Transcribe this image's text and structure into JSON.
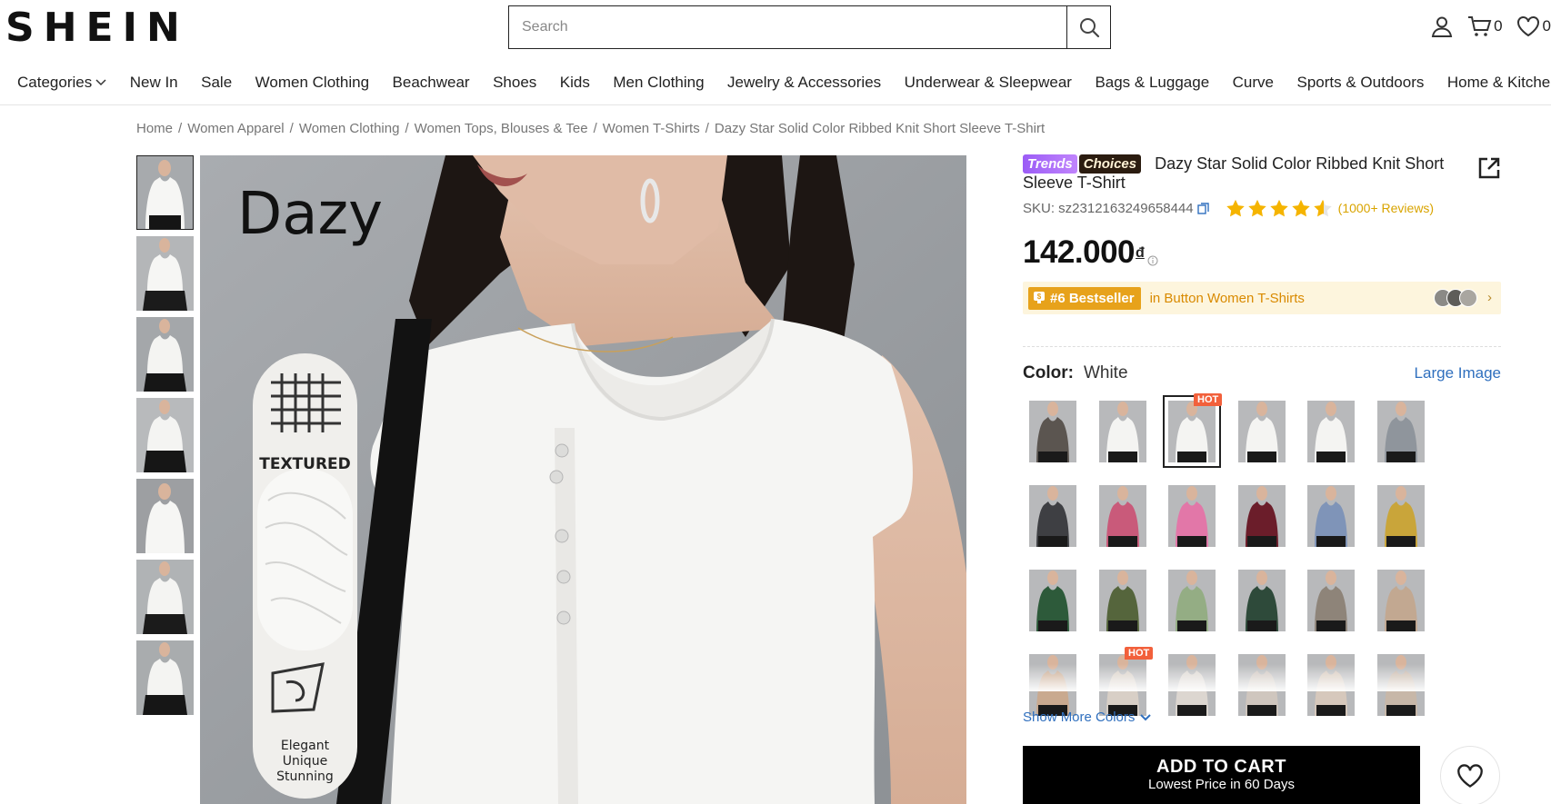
{
  "header": {
    "logo": "SHEIN",
    "search_placeholder": "Search",
    "icons": {
      "account": "user-icon",
      "cart": "cart-icon",
      "wishlist": "heart-icon",
      "search": "search-icon"
    },
    "cart_count": "0",
    "wishlist_count": "0"
  },
  "nav": {
    "items": [
      "Categories",
      "New In",
      "Sale",
      "Women Clothing",
      "Beachwear",
      "Shoes",
      "Kids",
      "Men Clothing",
      "Jewelry & Accessories",
      "Underwear & Sleepwear",
      "Bags & Luggage",
      "Curve",
      "Sports & Outdoors",
      "Home & Kitchen"
    ]
  },
  "breadcrumb": [
    "Home",
    "Women Apparel",
    "Women Clothing",
    "Women Tops, Blouses & Tee",
    "Women T-Shirts",
    "Dazy Star Solid Color Ribbed Knit Short Sleeve T-Shirt"
  ],
  "gallery": {
    "brand_text": "Dazy",
    "feature_1": "TEXTURED",
    "feature_2_line1": "Elegant",
    "feature_2_line2": "Unique",
    "feature_2_line3": "Stunning"
  },
  "product": {
    "tag_trends": "Trends",
    "tag_choices": "Choices",
    "title": "Dazy Star Solid Color Ribbed Knit Short Sleeve T-Shirt",
    "sku": "SKU: sz2312163249658444",
    "rating": 4.5,
    "reviews": "(1000+ Reviews)",
    "price": "142.000",
    "currency": "đ",
    "bestseller_rank": "#6 Bestseller",
    "bestseller_text": "in Button Women T-Shirts",
    "color_label": "Color:",
    "color_value": "White",
    "large_image": "Large Image",
    "hot_label": "HOT",
    "show_more_colors": "Show More Colors",
    "add_to_cart": "ADD TO CART",
    "add_to_cart_sub": "Lowest Price in 60 Days"
  },
  "colors": {
    "accent_link": "#2f6fbe",
    "star": "#f5b400",
    "hot": "#f2603b",
    "bestseller": "#e7a21b"
  },
  "swatch_colors": [
    [
      "#5b5550",
      "#f4f4f2",
      "#f4f4f2",
      "#f4f4f2",
      "#f4f4f2",
      "#8f959c"
    ],
    [
      "#3e3f43",
      "#c95a7a",
      "#e277a8",
      "#6b1d2a",
      "#7f94b8",
      "#c9a53a"
    ],
    [
      "#2d5a3a",
      "#55653c",
      "#94ad84",
      "#2e4a3a",
      "#8e8479",
      "#c2a891"
    ],
    [
      "#c9a98f",
      "#d8cfc6",
      "#dcd6d0",
      "#cfc6be",
      "#d6c8bc",
      "#c7b7a8"
    ]
  ]
}
